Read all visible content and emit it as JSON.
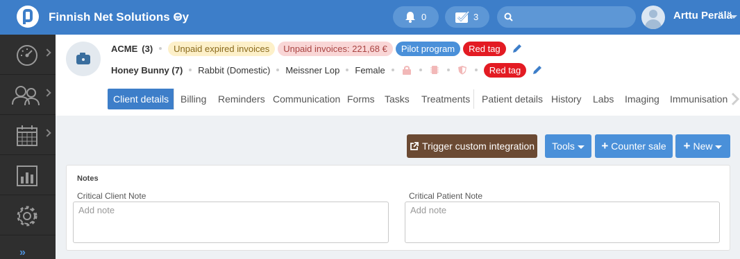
{
  "topbar": {
    "company": "Finnish Net Solutions Oy",
    "notifications_count": "0",
    "tasks_count": "3",
    "search_placeholder": "",
    "user_name": "Arttu Perälä"
  },
  "sidebar": {
    "items": [
      {
        "icon": "speedometer-icon"
      },
      {
        "icon": "clients-icon"
      },
      {
        "icon": "calendar-icon"
      },
      {
        "icon": "reports-icon"
      },
      {
        "icon": "settings-icon"
      }
    ],
    "expand_label": "»"
  },
  "client": {
    "name": "ACME",
    "count": "(3)",
    "badges": {
      "unpaid_expired": "Unpaid expired invoices",
      "unpaid_invoices": "Unpaid invoices: 221,68 €",
      "program": "Pilot program",
      "tag": "Red tag"
    }
  },
  "patient": {
    "name": "Honey Bunny (7)",
    "species": "Rabbit (Domestic)",
    "breed": "Meissner Lop",
    "sex": "Female",
    "tag": "Red tag"
  },
  "tabs": {
    "client_details": "Client details",
    "billing": "Billing",
    "reminders": "Reminders",
    "communication": "Communication",
    "forms": "Forms",
    "tasks": "Tasks",
    "treatments": "Treatments",
    "patient_details": "Patient details",
    "history": "History",
    "labs": "Labs",
    "imaging": "Imaging",
    "immunisation": "Immunisation"
  },
  "actions": {
    "trigger": "Trigger custom integration",
    "tools": "Tools",
    "counter_sale": "Counter sale",
    "new": "New"
  },
  "notes": {
    "title": "Notes",
    "client_label": "Critical Client Note",
    "client_placeholder": "Add note",
    "patient_label": "Critical Patient Note",
    "patient_placeholder": "Add note"
  },
  "colors": {
    "primary": "#3d7ec9",
    "sidebar": "#2f2f2f",
    "trigger_button": "#6b4a33",
    "red_tag": "#e31b23"
  }
}
